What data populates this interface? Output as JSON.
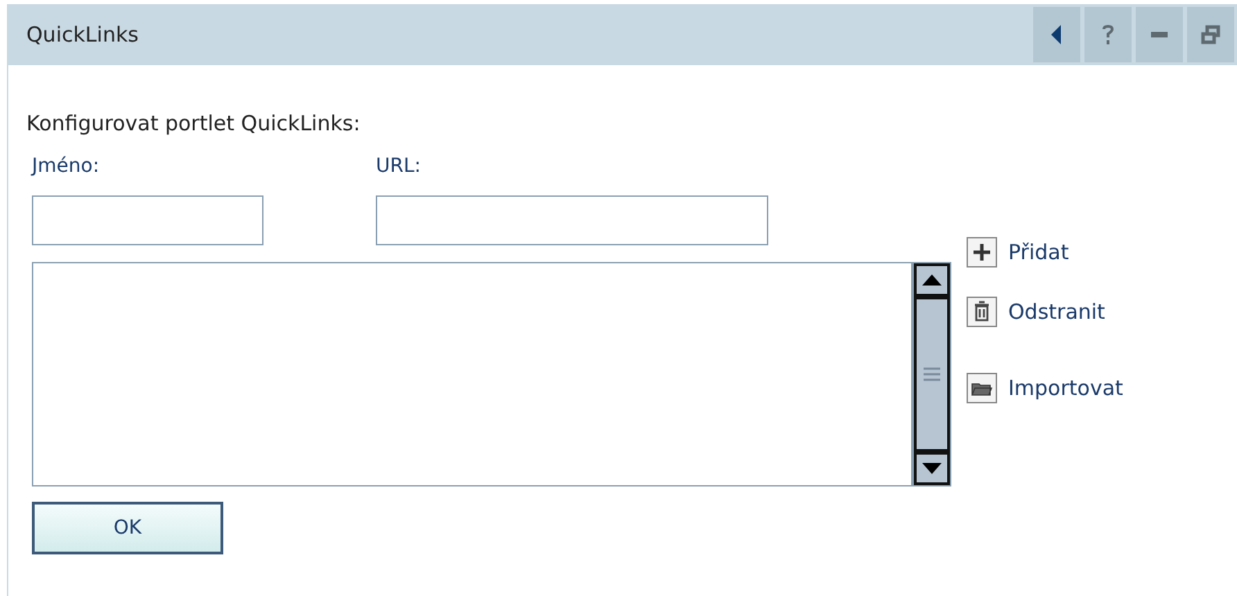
{
  "window": {
    "title": "QuickLinks"
  },
  "heading": "Konfigurovat portlet QuickLinks:",
  "fields": [
    {
      "label": "Jméno:"
    },
    {
      "label": "URL:"
    }
  ],
  "actions": [
    {
      "kind": "add",
      "label": "Přidat"
    },
    {
      "kind": "delete",
      "label": "Odstranit"
    },
    {
      "kind": "import",
      "label": "Importovat"
    }
  ],
  "ok_button": "OK"
}
